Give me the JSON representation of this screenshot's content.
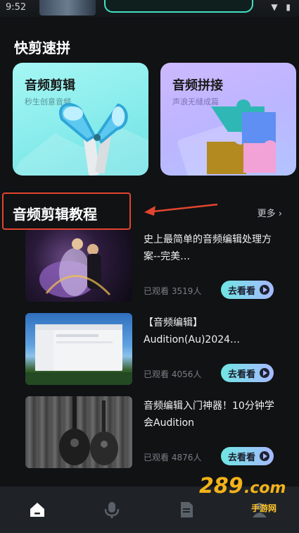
{
  "status": {
    "time": "9:52",
    "icons": "▼ ▮"
  },
  "quick_section": {
    "title": "快剪速拼"
  },
  "cards": [
    {
      "title": "音频剪辑",
      "subtitle": "秒生创意音频"
    },
    {
      "title": "音频拼接",
      "subtitle": "声浪无缝成篇"
    }
  ],
  "tutorial_section": {
    "title": "音频剪辑教程",
    "more": "更多 ›"
  },
  "tutorials": [
    {
      "title": "史上最简单的音频编辑处理方案--完美…",
      "views": "已观看 3519人",
      "button": "去看看"
    },
    {
      "title": "【音频编辑】Audition(Au)2024…",
      "views": "已观看 4056人",
      "button": "去看看"
    },
    {
      "title": "音频编辑入门神器！10分钟学会Audition",
      "views": "已观看 4876人",
      "button": "去看看"
    }
  ],
  "watermark": {
    "number": "289",
    "domain": ".com",
    "site": "手游网"
  },
  "colors": {
    "accent_cyan": "#6fe6e2",
    "accent_purple": "#a7b9ff",
    "highlight_red": "#e2452f"
  }
}
